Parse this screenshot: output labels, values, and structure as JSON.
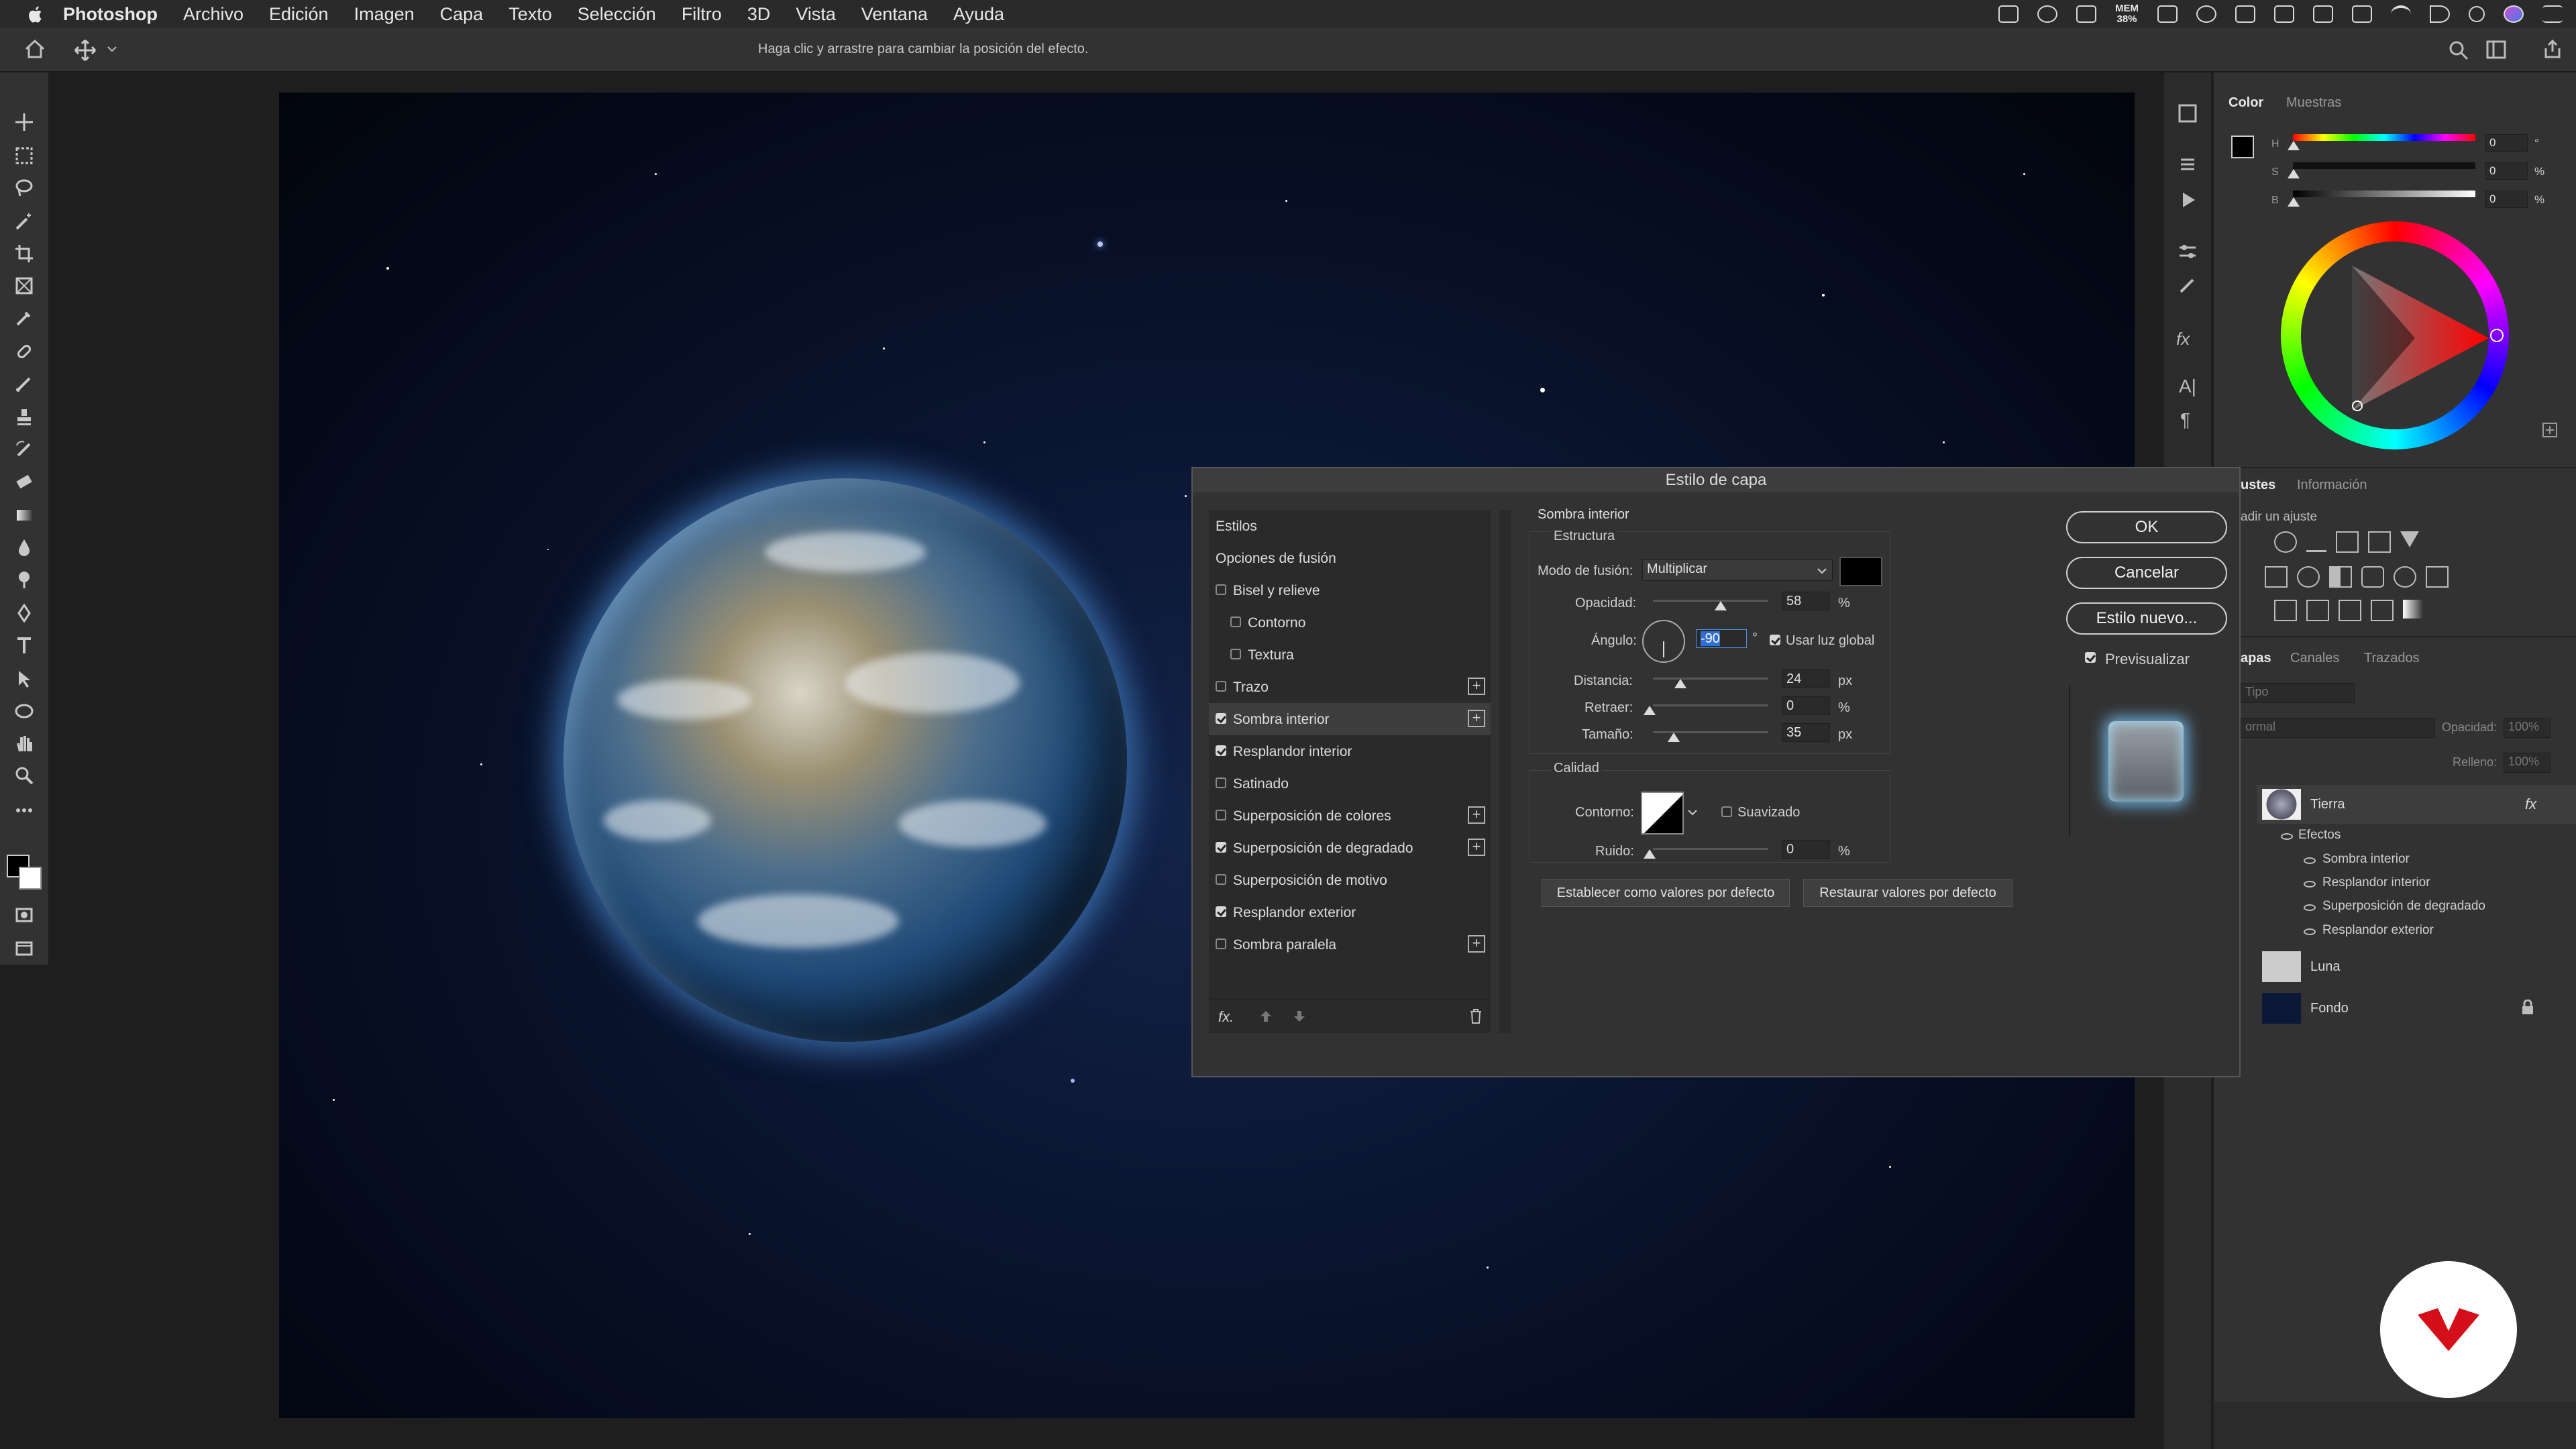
{
  "menubar": {
    "app": "Photoshop",
    "items": [
      "Archivo",
      "Edición",
      "Imagen",
      "Capa",
      "Texto",
      "Selección",
      "Filtro",
      "3D",
      "Vista",
      "Ventana",
      "Ayuda"
    ],
    "mem_label": "MEM",
    "mem_value": "38%"
  },
  "options_bar": {
    "hint": "Haga clic y arrastre para cambiar la posición del efecto."
  },
  "color_panel": {
    "tabs": [
      "Color",
      "Muestras"
    ],
    "labels": [
      "H",
      "S",
      "B"
    ],
    "values": [
      "0",
      "0",
      "0"
    ],
    "units": [
      "°",
      "%",
      "%"
    ]
  },
  "adjust_panel": {
    "tabs": [
      "ustes",
      "Información"
    ],
    "hint": "adir un ajuste"
  },
  "layers_panel": {
    "tabs": [
      "apas",
      "Canales",
      "Trazados"
    ],
    "filter": "Tipo",
    "blend": "ormal",
    "opacity_label": "Opacidad:",
    "opacity_value": "100%",
    "fill_label": "Relleno:",
    "fill_value": "100%",
    "layers": [
      {
        "name": "Tierra",
        "fx": "fx"
      },
      {
        "name": "Luna"
      },
      {
        "name": "Fondo"
      }
    ],
    "effects_label": "Efectos",
    "effects": [
      "Sombra interior",
      "Resplandor interior",
      "Superposición de degradado",
      "Resplandor exterior"
    ]
  },
  "dialog": {
    "title": "Estilo de capa",
    "styles_header": "Estilos",
    "blend_options": "Opciones de fusión",
    "styles": [
      {
        "label": "Bisel y relieve",
        "checked": false,
        "plus": false,
        "indent": false
      },
      {
        "label": "Contorno",
        "checked": false,
        "plus": false,
        "indent": true
      },
      {
        "label": "Textura",
        "checked": false,
        "plus": false,
        "indent": true
      },
      {
        "label": "Trazo",
        "checked": false,
        "plus": true,
        "indent": false
      },
      {
        "label": "Sombra interior",
        "checked": true,
        "plus": true,
        "indent": false,
        "selected": true
      },
      {
        "label": "Resplandor interior",
        "checked": true,
        "plus": false,
        "indent": false
      },
      {
        "label": "Satinado",
        "checked": false,
        "plus": false,
        "indent": false
      },
      {
        "label": "Superposición de colores",
        "checked": false,
        "plus": true,
        "indent": false
      },
      {
        "label": "Superposición de degradado",
        "checked": true,
        "plus": true,
        "indent": false
      },
      {
        "label": "Superposición de motivo",
        "checked": false,
        "plus": false,
        "indent": false
      },
      {
        "label": "Resplandor exterior",
        "checked": true,
        "plus": false,
        "indent": false
      },
      {
        "label": "Sombra paralela",
        "checked": false,
        "plus": true,
        "indent": false
      }
    ],
    "fx_label": "fx.",
    "section_title": "Sombra interior",
    "structure": "Estructura",
    "blend_mode_label": "Modo de fusión:",
    "blend_mode_value": "Multiplicar",
    "opacity_label": "Opacidad:",
    "opacity_value": "58",
    "angle_label": "Ángulo:",
    "angle_value": "-90",
    "angle_unit": "°",
    "global_light": "Usar luz global",
    "distance_label": "Distancia:",
    "distance_value": "24",
    "choke_label": "Retraer:",
    "choke_value": "0",
    "size_label": "Tamaño:",
    "size_value": "35",
    "px": "px",
    "pct": "%",
    "quality": "Calidad",
    "contour_label": "Contorno:",
    "antialias": "Suavizado",
    "noise_label": "Ruido:",
    "noise_value": "0",
    "set_default": "Establecer como valores por defecto",
    "reset_default": "Restaurar valores por defecto",
    "ok": "OK",
    "cancel": "Cancelar",
    "new_style": "Estilo nuevo...",
    "preview": "Previsualizar"
  }
}
